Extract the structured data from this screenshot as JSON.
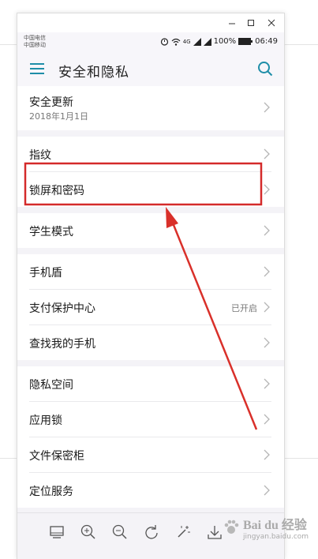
{
  "status": {
    "carrier1": "中国电信",
    "carrier2": "中国移动",
    "network": "4G",
    "battery": "100%",
    "time": "06:49"
  },
  "header": {
    "title": "安全和隐私"
  },
  "groups": [
    {
      "items": [
        {
          "label": "安全更新",
          "sub": "2018年1月1日"
        }
      ]
    },
    {
      "items": [
        {
          "label": "指纹"
        },
        {
          "label": "锁屏和密码"
        }
      ]
    },
    {
      "items": [
        {
          "label": "学生模式"
        }
      ]
    },
    {
      "items": [
        {
          "label": "手机盾"
        },
        {
          "label": "支付保护中心",
          "value": "已开启"
        },
        {
          "label": "查找我的手机"
        }
      ]
    },
    {
      "items": [
        {
          "label": "隐私空间"
        },
        {
          "label": "应用锁"
        },
        {
          "label": "文件保密柜"
        },
        {
          "label": "定位服务"
        }
      ]
    }
  ],
  "toolbar": [
    "fit-screen-icon",
    "zoom-in-icon",
    "zoom-out-icon",
    "rotate-icon",
    "magic-wand-icon",
    "download-icon"
  ],
  "colors": {
    "accent": "#1e8ea8",
    "highlight": "#d42a2a",
    "arrow": "#d9302a"
  },
  "watermark": {
    "text": "Bai du 经验",
    "sub": "jingyan.baidu.com"
  }
}
